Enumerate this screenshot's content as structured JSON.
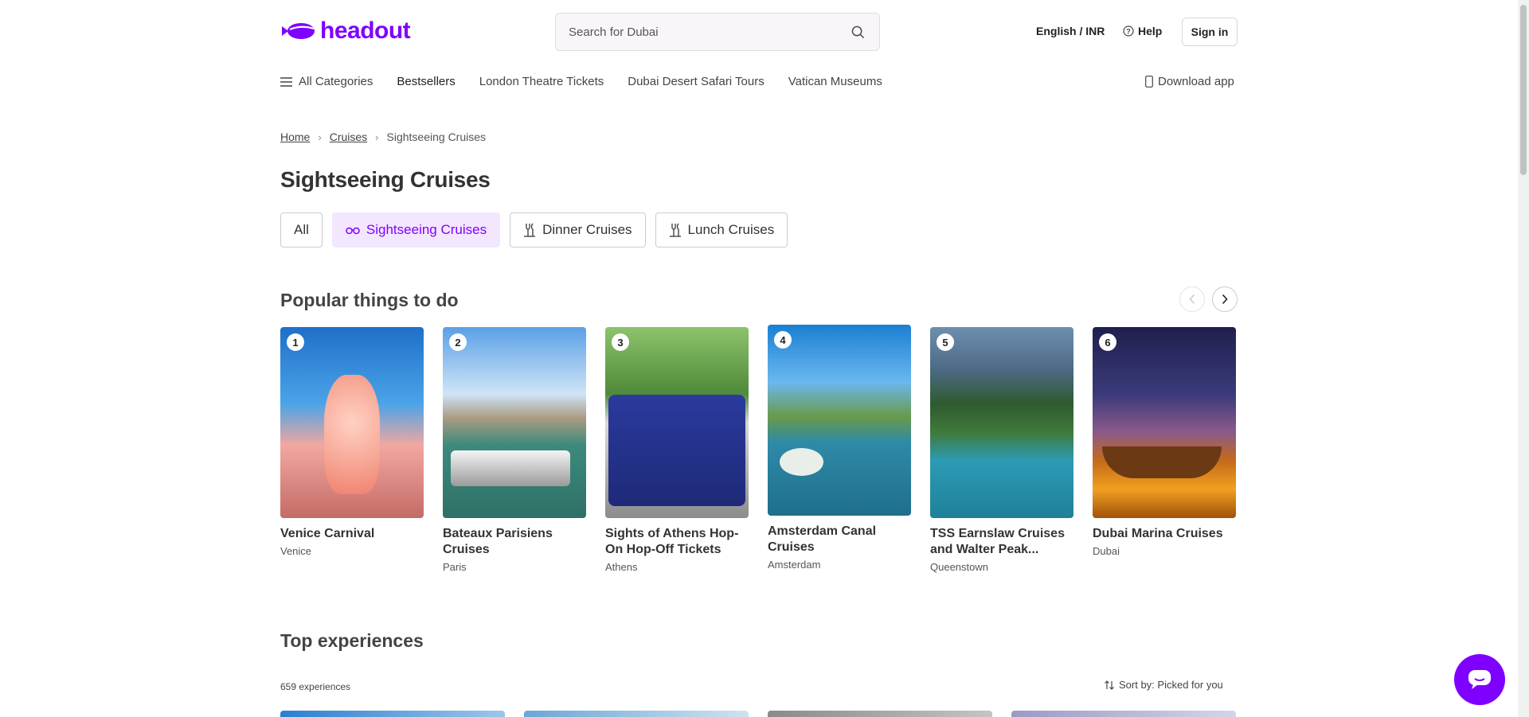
{
  "header": {
    "logo_text": "headout",
    "search_placeholder": "Search for Dubai",
    "language": "English / INR",
    "help": "Help",
    "sign_in": "Sign in"
  },
  "nav": {
    "categories": "All Categories",
    "items": [
      "Bestsellers",
      "London Theatre Tickets",
      "Dubai Desert Safari Tours",
      "Vatican Museums"
    ],
    "download": "Download app"
  },
  "breadcrumb": [
    "Home",
    "Cruises",
    "Sightseeing Cruises"
  ],
  "page_title": "Sightseeing Cruises",
  "filters": [
    {
      "label": "All",
      "active": false
    },
    {
      "label": "Sightseeing Cruises",
      "active": true
    },
    {
      "label": "Dinner Cruises",
      "active": false
    },
    {
      "label": "Lunch Cruises",
      "active": false
    }
  ],
  "popular": {
    "title": "Popular things to do",
    "cards": [
      {
        "rank": "1",
        "name": "Venice Carnival",
        "city": "Venice"
      },
      {
        "rank": "2",
        "name": "Bateaux Parisiens Cruises",
        "city": "Paris"
      },
      {
        "rank": "3",
        "name": "Sights of Athens Hop-On Hop-Off Tickets",
        "city": "Athens"
      },
      {
        "rank": "4",
        "name": "Amsterdam Canal Cruises",
        "city": "Amsterdam"
      },
      {
        "rank": "5",
        "name": "TSS Earnslaw Cruises and Walter Peak...",
        "city": "Queenstown"
      },
      {
        "rank": "6",
        "name": "Dubai Marina Cruises",
        "city": "Dubai"
      }
    ]
  },
  "top_experiences": {
    "title": "Top experiences",
    "count": "659 experiences",
    "sort": "Sort by: Picked for you"
  },
  "colors": {
    "brand": "#8000ff",
    "chip_active_bg": "#f3e6ff"
  }
}
